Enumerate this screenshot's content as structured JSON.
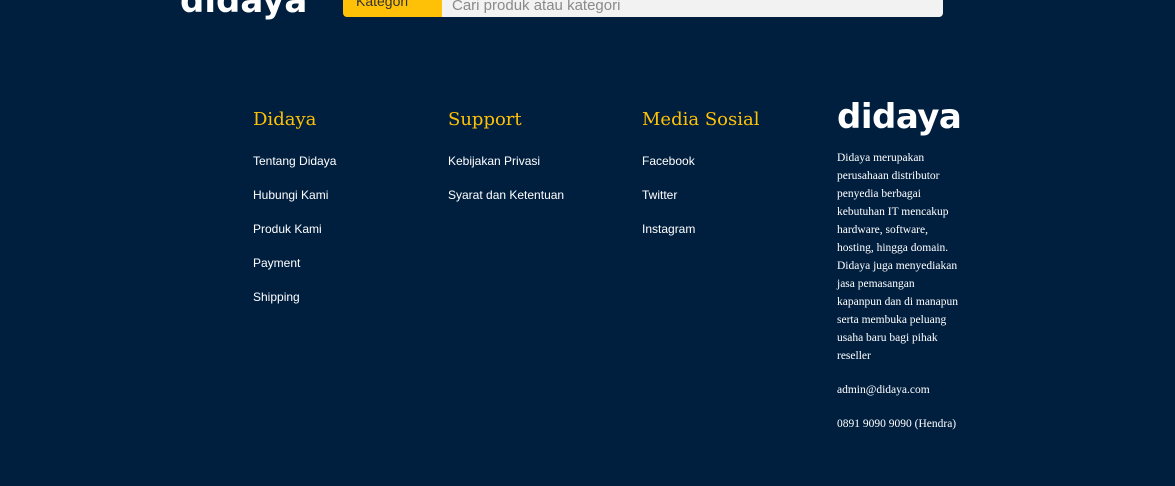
{
  "header": {
    "logo_text": "didaya",
    "category_button_label": "Kategori",
    "search_placeholder": "Cari produk atau kategori"
  },
  "footer": {
    "columns": [
      {
        "title": "Didaya",
        "links": [
          "Tentang Didaya",
          "Hubungi Kami",
          "Produk Kami",
          "Payment",
          "Shipping"
        ]
      },
      {
        "title": "Support",
        "links": [
          "Kebijakan Privasi",
          "Syarat dan Ketentuan"
        ]
      },
      {
        "title": "Media Sosial",
        "links": [
          "Facebook",
          "Twitter",
          "Instagram"
        ]
      }
    ],
    "about": {
      "logo_text": "didaya",
      "description": "Didaya merupakan perusahaan distributor penyedia berbagai kebutuhan IT mencakup hardware, software, hosting, hingga domain. Didaya juga menyediakan jasa pemasangan kapanpun dan di manapun serta membuka peluang usaha baru bagi pihak reseller",
      "email": "admin@didaya.com",
      "phone": "0891 9090 9090 (Hendra)"
    }
  },
  "colors": {
    "background": "#001f3f",
    "accent": "#ffc107",
    "text": "#ffffff"
  }
}
